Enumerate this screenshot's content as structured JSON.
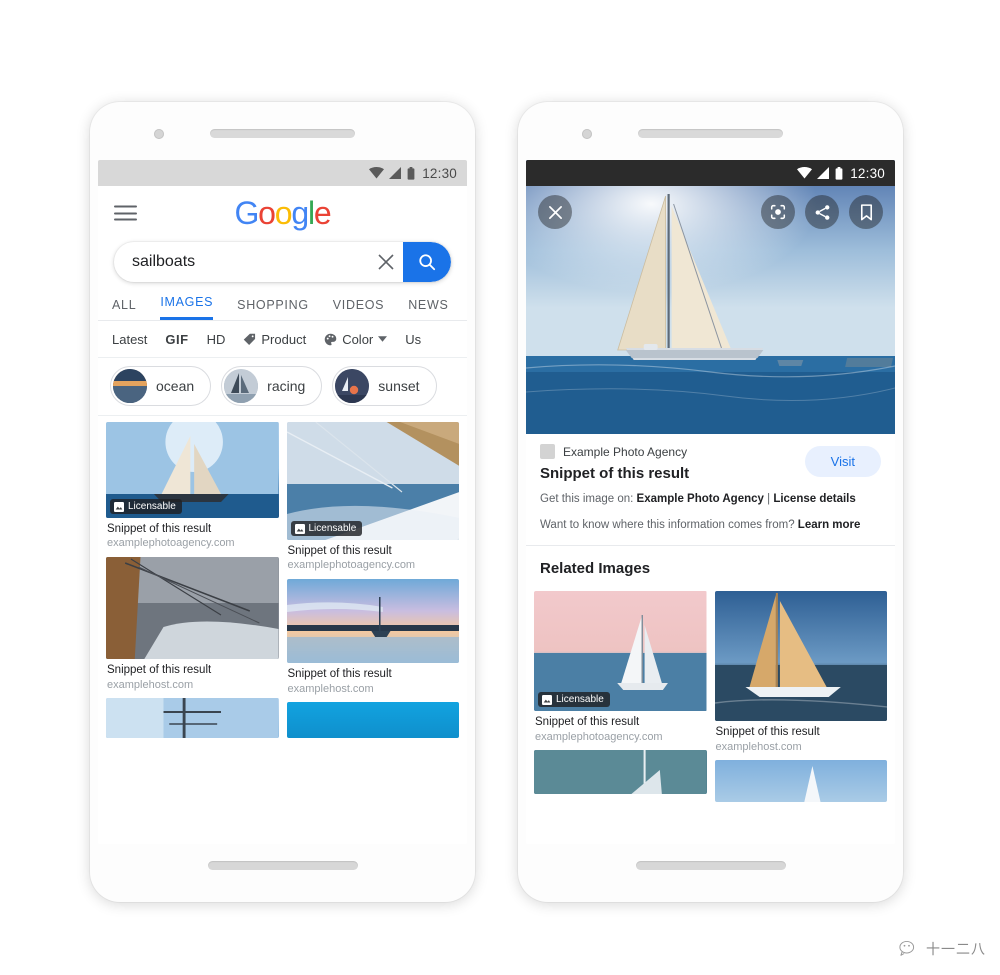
{
  "watermark": {
    "text": "十一二八",
    "icon": "wechat-icon"
  },
  "left_phone": {
    "status_bar": {
      "time": "12:30",
      "wifi": "wifi-icon",
      "signal": "signal-icon",
      "battery": "battery-icon"
    },
    "header": {
      "menu_icon": "hamburger-icon",
      "logo_letters": [
        {
          "ch": "G",
          "color": "#4285F4"
        },
        {
          "ch": "o",
          "color": "#EA4335"
        },
        {
          "ch": "o",
          "color": "#FBBC05"
        },
        {
          "ch": "g",
          "color": "#4285F4"
        },
        {
          "ch": "l",
          "color": "#34A853"
        },
        {
          "ch": "e",
          "color": "#EA4335"
        }
      ]
    },
    "search": {
      "value": "sailboats",
      "placeholder": "Search",
      "clear_icon": "close-icon",
      "submit_icon": "search-icon",
      "submit_color": "#1a73e8"
    },
    "tabs": [
      {
        "label": "ALL",
        "active": false
      },
      {
        "label": "IMAGES",
        "active": true
      },
      {
        "label": "SHOPPING",
        "active": false
      },
      {
        "label": "VIDEOS",
        "active": false
      },
      {
        "label": "NEWS",
        "active": false
      }
    ],
    "filters": [
      {
        "label": "Latest",
        "icon": null,
        "bold": false,
        "caret": false
      },
      {
        "label": "GIF",
        "icon": null,
        "bold": true,
        "caret": false
      },
      {
        "label": "HD",
        "icon": null,
        "bold": false,
        "caret": false
      },
      {
        "label": "Product",
        "icon": "tag-icon",
        "bold": false,
        "caret": false
      },
      {
        "label": "Color",
        "icon": "palette-icon",
        "bold": false,
        "caret": true
      },
      {
        "label": "Us",
        "icon": null,
        "bold": false,
        "caret": false
      }
    ],
    "chips": [
      {
        "label": "ocean",
        "thumb": "ocean-thumb"
      },
      {
        "label": "racing",
        "thumb": "racing-thumb"
      },
      {
        "label": "sunset",
        "thumb": "sunset-thumb"
      }
    ],
    "results": [
      {
        "snippet": "Snippet of this result",
        "host": "examplephotoagency.com",
        "badge": "Licensable",
        "col": 0
      },
      {
        "snippet": "Snippet of this result",
        "host": "examplephotoagency.com",
        "badge": "Licensable",
        "col": 1
      },
      {
        "snippet": "Snippet of this result",
        "host": "examplehost.com",
        "badge": null,
        "col": 0
      },
      {
        "snippet": "Snippet of this result",
        "host": "examplehost.com",
        "badge": null,
        "col": 1
      }
    ]
  },
  "right_phone": {
    "status_bar": {
      "time": "12:30",
      "wifi": "wifi-icon",
      "signal": "signal-icon",
      "battery": "battery-icon"
    },
    "hero_actions": {
      "close_icon": "close-icon",
      "lens_icon": "google-lens-icon",
      "share_icon": "share-icon",
      "bookmark_icon": "bookmark-icon"
    },
    "detail": {
      "source_name": "Example Photo Agency",
      "favicon": "site-favicon",
      "title": "Snippet of this result",
      "visit_label": "Visit",
      "get_image_prefix": "Get this image on: ",
      "get_image_source": "Example Photo Agency",
      "get_image_sep": " | ",
      "license_link": "License details",
      "learn_prefix": "Want to know where this information comes from? ",
      "learn_link": "Learn more"
    },
    "related": {
      "heading": "Related Images",
      "items": [
        {
          "snippet": "Snippet of this result",
          "host": "examplephotoagency.com",
          "badge": "Licensable"
        },
        {
          "snippet": "Snippet of this result",
          "host": "examplehost.com",
          "badge": null
        }
      ]
    }
  }
}
